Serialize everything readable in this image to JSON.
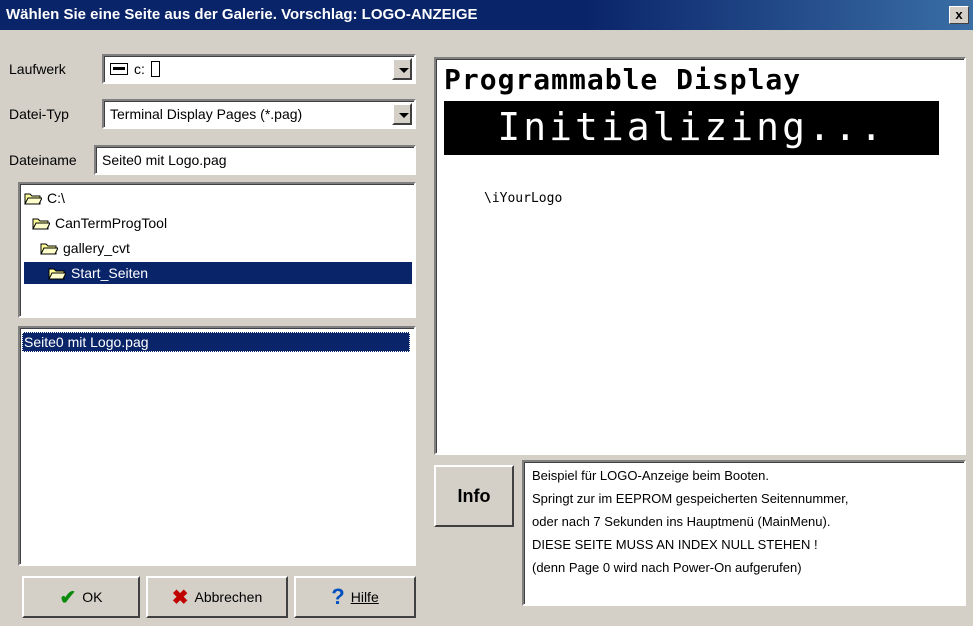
{
  "window": {
    "title": "Wählen Sie eine Seite aus der Galerie.  Vorschlag: LOGO-ANZEIGE",
    "close_label": "x"
  },
  "form": {
    "drive_label": "Laufwerk",
    "drive_value": "c:",
    "filetype_label": "Datei-Typ",
    "filetype_value": "Terminal Display Pages  (*.pag)",
    "filename_label": "Dateiname",
    "filename_value": "Seite0 mit Logo.pag"
  },
  "tree": {
    "items": [
      {
        "label": "C:\\",
        "icon": "folder-open-icon"
      },
      {
        "label": "CanTermProgTool",
        "icon": "folder-open-icon"
      },
      {
        "label": "gallery_cvt",
        "icon": "folder-open-icon"
      },
      {
        "label": "Start_Seiten",
        "icon": "folder-open-icon",
        "selected": true
      }
    ]
  },
  "files": {
    "items": [
      {
        "label": "Seite0 mit Logo.pag",
        "selected": true
      }
    ]
  },
  "buttons": {
    "ok": "OK",
    "cancel": "Abbrechen",
    "help": "Hilfe"
  },
  "preview": {
    "line1": "Programmable Display",
    "line2": "Initializing...",
    "logo_text": "\\iYourLogo"
  },
  "info": {
    "button_label": "Info",
    "lines": [
      "Beispiel für LOGO-Anzeige beim Booten.",
      "Springt zur im EEPROM gespeicherten Seitennummer,",
      "oder nach 7 Sekunden ins Hauptmenü (MainMenu).",
      "DIESE SEITE MUSS AN INDEX NULL STEHEN !",
      "(denn Page 0 wird nach Power-On aufgerufen)"
    ]
  },
  "colors": {
    "titlebar": "#0a246a",
    "selection": "#0a246a",
    "face": "#d4d0c8"
  }
}
